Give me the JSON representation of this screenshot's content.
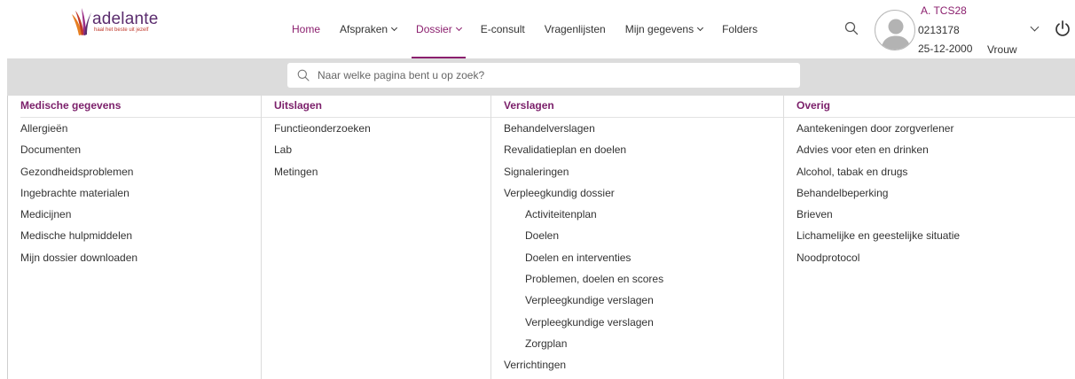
{
  "brand": {
    "name": "adelante",
    "tagline": "haal het beste uit jezelf",
    "colors": {
      "primary": "#8b1f6e",
      "logo_red": "#c0392b",
      "logo_purple": "#5b2d6e",
      "logo_orange": "#e67e22"
    }
  },
  "nav": {
    "items": [
      {
        "label": "Home",
        "active": true
      },
      {
        "label": "Afspraken",
        "dropdown": true
      },
      {
        "label": "Dossier",
        "dropdown": true,
        "open": true
      },
      {
        "label": "E-consult"
      },
      {
        "label": "Vragenlijsten"
      },
      {
        "label": "Mijn gegevens",
        "dropdown": true
      },
      {
        "label": "Folders"
      }
    ],
    "search_icon": "search-icon"
  },
  "user": {
    "name": "A. TCS28",
    "id": "0213178",
    "dob": "25-12-2000",
    "gender": "Vrouw",
    "avatar_icon": "avatar-placeholder-icon",
    "menu_icon": "chevron-down-icon",
    "logout_icon": "power-icon"
  },
  "search": {
    "placeholder": "Naar welke pagina bent u op zoek?"
  },
  "menu": {
    "columns": [
      {
        "title": "Medische gegevens",
        "links": [
          {
            "label": "Allergieën"
          },
          {
            "label": "Documenten"
          },
          {
            "label": "Gezondheidsproblemen"
          },
          {
            "label": "Ingebrachte materialen"
          },
          {
            "label": "Medicijnen"
          },
          {
            "label": "Medische hulpmiddelen"
          },
          {
            "label": "Mijn dossier downloaden"
          }
        ]
      },
      {
        "title": "Uitslagen",
        "links": [
          {
            "label": "Functieonderzoeken"
          },
          {
            "label": "Lab"
          },
          {
            "label": "Metingen"
          }
        ]
      },
      {
        "title": "Verslagen",
        "links": [
          {
            "label": "Behandelverslagen"
          },
          {
            "label": "Revalidatieplan en doelen"
          },
          {
            "label": "Signaleringen"
          },
          {
            "label": "Verpleegkundig dossier"
          },
          {
            "label": "Activiteitenplan",
            "sub": true
          },
          {
            "label": "Doelen",
            "sub": true
          },
          {
            "label": "Doelen en interventies",
            "sub": true
          },
          {
            "label": "Problemen, doelen en scores",
            "sub": true
          },
          {
            "label": "Verpleegkundige verslagen",
            "sub": true
          },
          {
            "label": "Verpleegkundige verslagen",
            "sub": true
          },
          {
            "label": "Zorgplan",
            "sub": true
          },
          {
            "label": "Verrichtingen"
          }
        ]
      },
      {
        "title": "Overig",
        "links": [
          {
            "label": "Aantekeningen door zorgverlener"
          },
          {
            "label": "Advies voor eten en drinken"
          },
          {
            "label": "Alcohol, tabak en drugs"
          },
          {
            "label": "Behandelbeperking"
          },
          {
            "label": "Brieven"
          },
          {
            "label": "Lichamelijke en geestelijke situatie"
          },
          {
            "label": "Noodprotocol"
          }
        ]
      }
    ]
  }
}
